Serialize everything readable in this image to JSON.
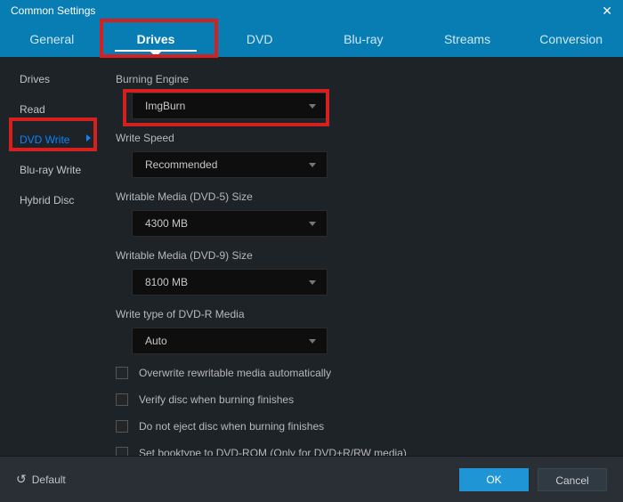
{
  "header": {
    "title": "Common Settings",
    "close_label": "✕"
  },
  "tabs": [
    "General",
    "Drives",
    "DVD",
    "Blu-ray",
    "Streams",
    "Conversion"
  ],
  "active_tab_index": 1,
  "sidebar": {
    "items": [
      "Drives",
      "Read",
      "DVD Write",
      "Blu-ray Write",
      "Hybrid Disc"
    ],
    "active_index": 2
  },
  "fields": [
    {
      "label": "Burning Engine",
      "value": "ImgBurn",
      "highlight": true
    },
    {
      "label": "Write Speed",
      "value": "Recommended"
    },
    {
      "label": "Writable Media (DVD-5) Size",
      "value": "4300 MB"
    },
    {
      "label": "Writable Media (DVD-9) Size",
      "value": "8100 MB"
    },
    {
      "label": "Write type of DVD-R Media",
      "value": "Auto"
    }
  ],
  "checks": [
    "Overwrite rewritable media automatically",
    "Verify disc when burning finishes",
    "Do not eject disc when burning finishes",
    "Set booktype to DVD-ROM (Only for DVD+R/RW media)"
  ],
  "footer": {
    "default_label": "Default",
    "ok_label": "OK",
    "cancel_label": "Cancel"
  }
}
